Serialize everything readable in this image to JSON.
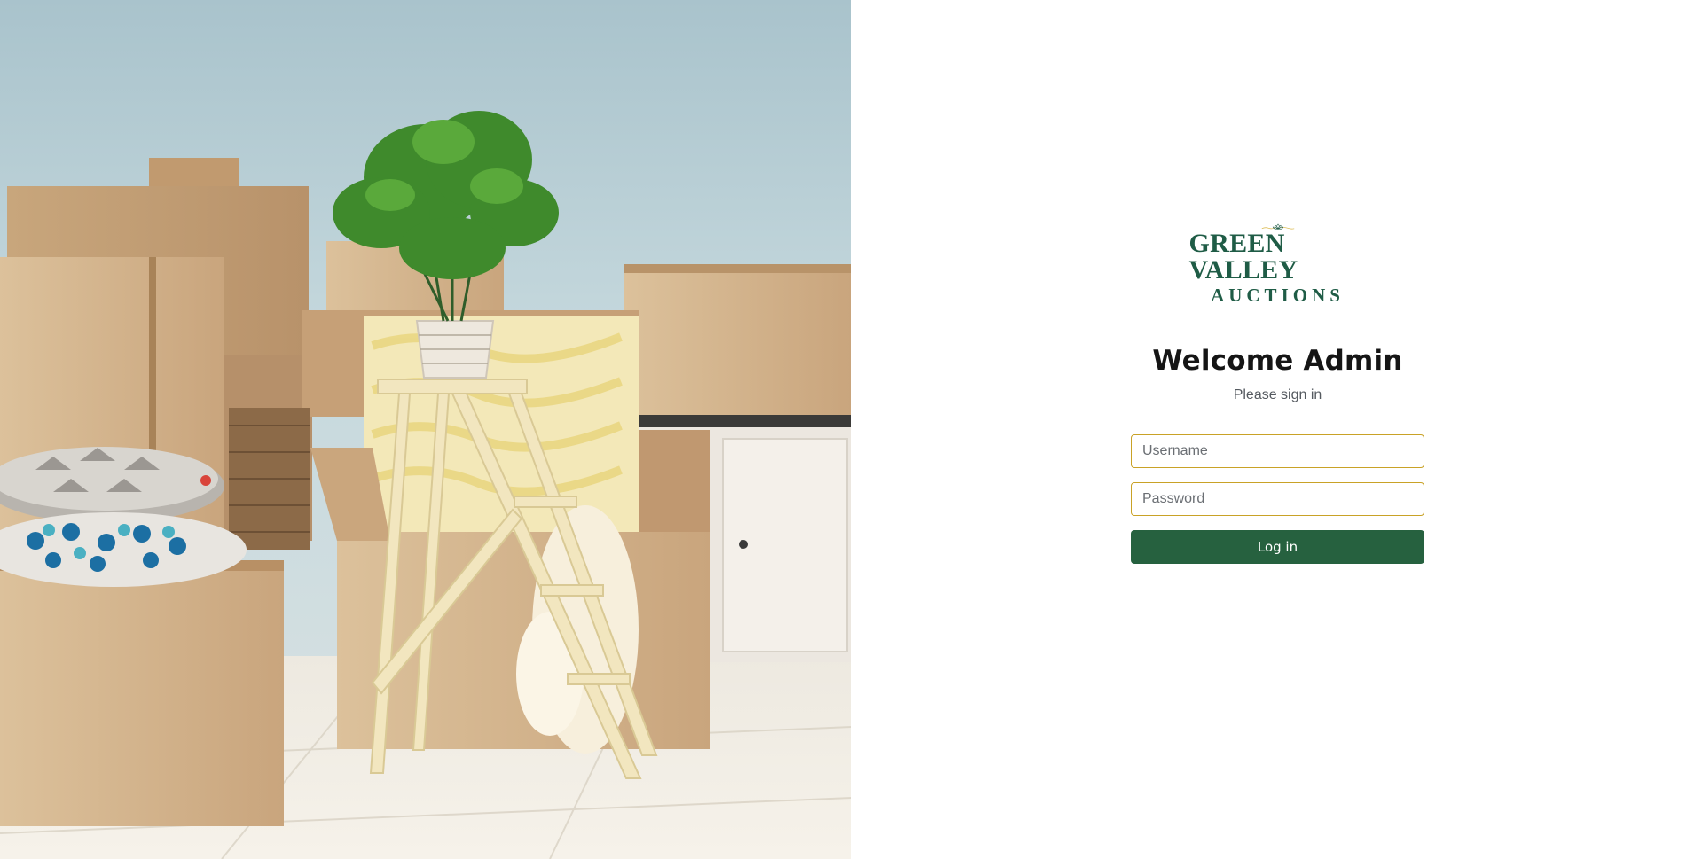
{
  "brand": {
    "line1": "GREEN VALLEY",
    "line2": "AUCTIONS",
    "primary_color": "#1f5c46",
    "accent_color": "#d8b440"
  },
  "login": {
    "title": "Welcome Admin",
    "subtitle": "Please sign in",
    "username_placeholder": "Username",
    "password_placeholder": "Password",
    "submit_label": "Log in",
    "button_color": "#26613f",
    "field_border_color": "#c9a227"
  },
  "hero": {
    "icon": "moving-boxes-illustration"
  }
}
